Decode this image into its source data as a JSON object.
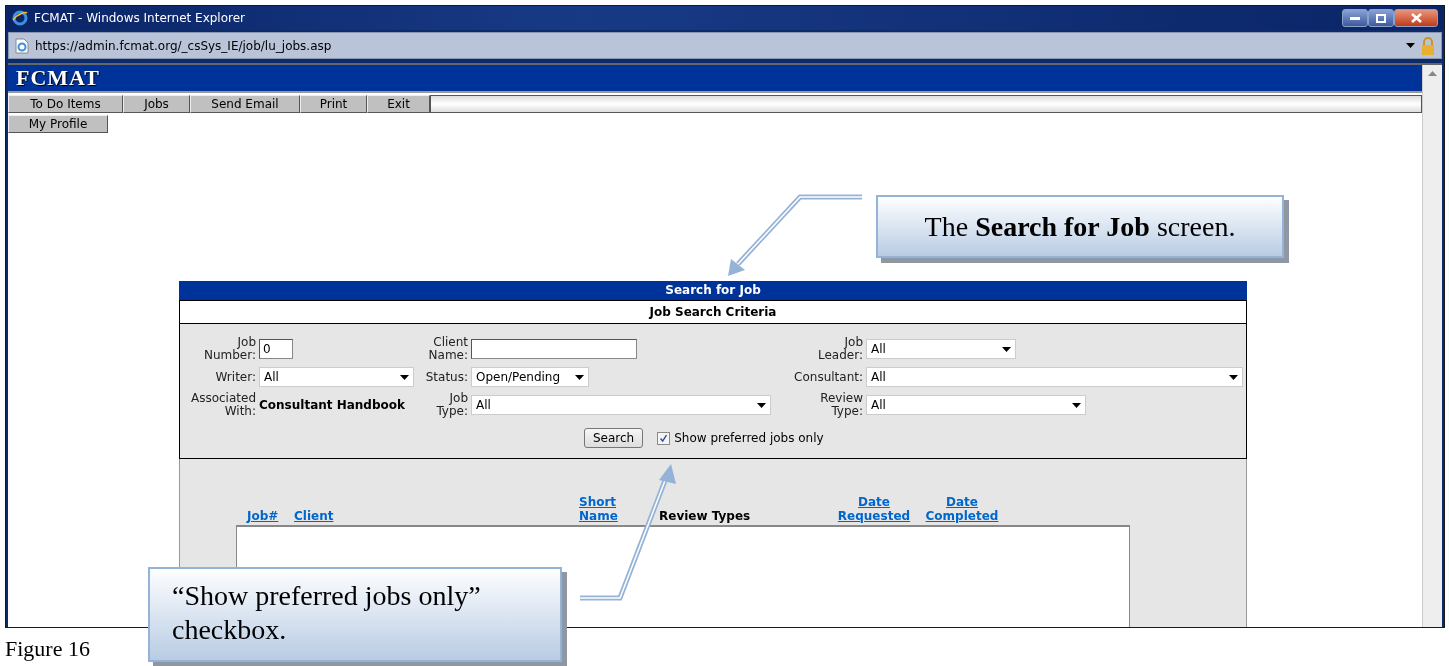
{
  "window": {
    "title": "FCMAT - Windows Internet Explorer",
    "address": "https://admin.fcmat.org/_csSys_IE/job/lu_jobs.asp"
  },
  "app": {
    "logo": "FCMAT",
    "menu": [
      "To Do Items",
      "Jobs",
      "Send Email",
      "Print",
      "Exit"
    ],
    "menu_row2": [
      "My Profile"
    ]
  },
  "panel": {
    "title": "Search for Job",
    "section_title": "Job Search Criteria",
    "fields": [
      {
        "label": "Job\nNumber:",
        "kind": "text",
        "value": "0"
      },
      {
        "label": "Client\nName:",
        "kind": "text"
      },
      {
        "label": "Job\nLeader:",
        "kind": "select",
        "value": "All"
      },
      {
        "label": "Writer:",
        "kind": "select",
        "value": "All"
      },
      {
        "label": "Status:",
        "kind": "select",
        "value": "Open/Pending"
      },
      {
        "label": "Consultant:",
        "kind": "select",
        "value": "All"
      },
      {
        "label": "Associated\nWith:",
        "kind": "static",
        "value": "Consultant Handbook"
      },
      {
        "label": "Job\nType:",
        "kind": "select",
        "value": "All"
      },
      {
        "label": "Review\nType:",
        "kind": "select",
        "value": "All"
      }
    ],
    "search_button": "Search",
    "preferred_checkbox": {
      "label": "Show preferred jobs only",
      "checked": true
    },
    "columns": [
      {
        "label": "Job#",
        "link": true
      },
      {
        "label": "Client",
        "link": true
      },
      {
        "label": "Short\nName",
        "link": true
      },
      {
        "label": "Review Types",
        "link": false
      },
      {
        "label": "Date\nRequested",
        "link": true
      },
      {
        "label": "Date\nCompleted",
        "link": true
      }
    ]
  },
  "callouts": [
    {
      "text": "The **Search for Job** screen."
    },
    {
      "text": "“Show preferred jobs only” checkbox."
    }
  ],
  "caption": "Figure 16"
}
